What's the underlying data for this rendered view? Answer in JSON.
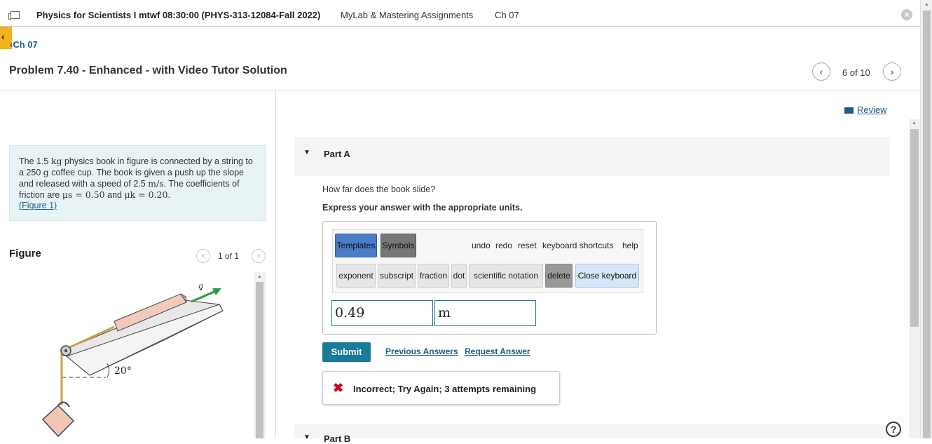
{
  "header": {
    "course_title": "Physics for Scientists I mtwf 08:30:00 (PHYS-313-12084-Fall 2022)",
    "nav_assignments": "MyLab & Mastering Assignments",
    "nav_chapter": "Ch 07",
    "close_glyph": "×"
  },
  "back_link": "Ch 07",
  "problem": {
    "title": "Problem 7.40 - Enhanced - with Video Tutor Solution",
    "pager_text": "6 of 10",
    "review_label": "Review"
  },
  "statement": {
    "p1": "The 1.5",
    "unit_kg": "kg",
    "p2": "physics book in figure is connected by a string to a 250",
    "unit_g": "g",
    "p3": "coffee cup. The book is given a push up the slope and released with a speed of 2.5",
    "unit_ms": "m/s",
    "p4": ". The coefficients of friction are",
    "mu_s": "μs = 0.50",
    "p5": "and",
    "mu_k": "μk = 0.20.",
    "figure_link": "(Figure 1)"
  },
  "figure": {
    "label": "Figure",
    "pager_text": "1 of 1",
    "angle_label": "20°",
    "velocity_label": "v⃗"
  },
  "partA": {
    "label": "Part A",
    "question": "How far does the book slide?",
    "instruction": "Express your answer with the appropriate units.",
    "toolbar": {
      "templates": "Templates",
      "symbols": "Symbols",
      "undo": "undo",
      "redo": "redo",
      "reset": "reset",
      "shortcuts": "keyboard shortcuts",
      "help": "help",
      "exponent": "exponent",
      "subscript": "subscript",
      "fraction": "fraction",
      "dot": "dot",
      "scientific": "scientific notation",
      "delete": "delete",
      "close_keyboard": "Close keyboard"
    },
    "value": "0.49",
    "unit": "m",
    "submit": "Submit",
    "previous_answers": "Previous Answers",
    "request_answer": "Request Answer",
    "feedback": "Incorrect; Try Again; 3 attempts remaining"
  },
  "partB": {
    "label": "Part B"
  },
  "colors": {
    "accent": "#1a7a9a",
    "error": "#d0021b",
    "link": "#1a5b86",
    "tab": "#f5b21c"
  }
}
